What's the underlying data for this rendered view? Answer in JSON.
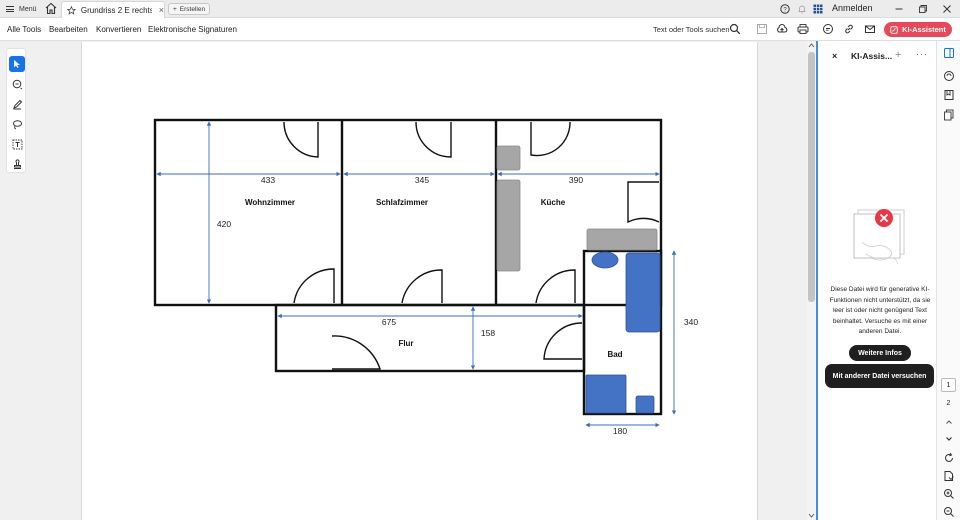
{
  "tabbar": {
    "menu_label": "Menü",
    "doc_tab_title": "Grundriss 2 E rechts...",
    "new_tab_label": "Erstellen",
    "signin_label": "Anmelden"
  },
  "menubar": {
    "items": [
      "Alle Tools",
      "Bearbeiten",
      "Konvertieren",
      "Elektronische Signaturen"
    ],
    "search_label": "Text oder Tools suchen",
    "ai_button_label": "KI-Assistent"
  },
  "tools": [
    "select-tool",
    "comment-tool",
    "draw-tool",
    "lasso-tool",
    "text-edit-tool",
    "stamp-tool"
  ],
  "floorplan": {
    "rooms": {
      "wohnzimmer": "Wohnzimmer",
      "schlafzimmer": "Schlafzimmer",
      "kueche": "Küche",
      "flur": "Flur",
      "bad": "Bad"
    },
    "dimensions": {
      "wohnzimmer_width": "433",
      "wohnzimmer_height": "420",
      "schlafzimmer_width": "345",
      "kueche_width": "390",
      "flur_width": "675",
      "flur_height": "158",
      "bad_height": "340",
      "bad_width": "180"
    }
  },
  "ai_panel": {
    "title": "KI-Assis...",
    "message": "Diese Datei wird für generative KI-Funktionen nicht unterstützt, da sie leer ist oder nicht genügend Text beinhaltet. Versuche es mit einer anderen Datei.",
    "info_button": "Weitere Infos",
    "other_file_button": "Mit anderer Datei versuchen"
  },
  "pages": {
    "current": "1",
    "next": "2"
  },
  "colors": {
    "ai_accent": "#e44a59",
    "selection_blue": "#1473e6",
    "fixture_blue": "#4472c4",
    "dimension_blue": "#3b6fb5"
  }
}
